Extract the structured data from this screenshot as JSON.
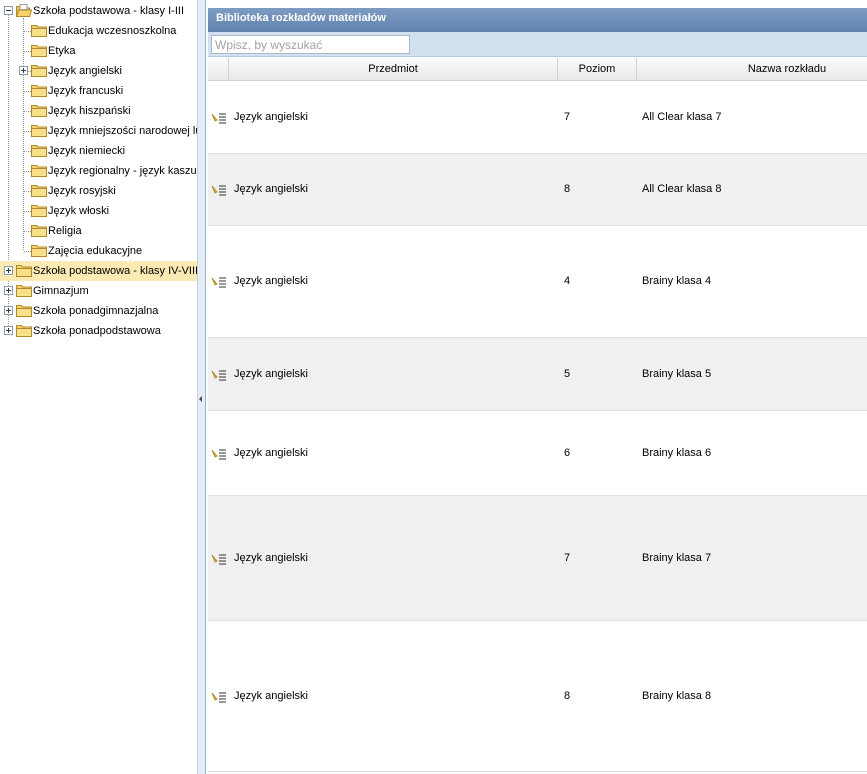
{
  "tree": {
    "items": [
      {
        "label": "Szkoła podstawowa - klasy I-III",
        "level": 0,
        "expander": "minus",
        "open": true,
        "selected": false
      },
      {
        "label": "Edukacja wczesnoszkolna",
        "level": 1,
        "expander": "none",
        "open": false,
        "selected": false
      },
      {
        "label": "Etyka",
        "level": 1,
        "expander": "none",
        "open": false,
        "selected": false
      },
      {
        "label": "Język angielski",
        "level": 1,
        "expander": "plus",
        "open": false,
        "selected": false
      },
      {
        "label": "Język francuski",
        "level": 1,
        "expander": "none",
        "open": false,
        "selected": false
      },
      {
        "label": "Język hiszpański",
        "level": 1,
        "expander": "none",
        "open": false,
        "selected": false
      },
      {
        "label": "Język mniejszości narodowej lu",
        "level": 1,
        "expander": "none",
        "open": false,
        "selected": false
      },
      {
        "label": "Język niemiecki",
        "level": 1,
        "expander": "none",
        "open": false,
        "selected": false
      },
      {
        "label": "Język regionalny - język kaszub",
        "level": 1,
        "expander": "none",
        "open": false,
        "selected": false
      },
      {
        "label": "Język rosyjski",
        "level": 1,
        "expander": "none",
        "open": false,
        "selected": false
      },
      {
        "label": "Język włoski",
        "level": 1,
        "expander": "none",
        "open": false,
        "selected": false
      },
      {
        "label": "Religia",
        "level": 1,
        "expander": "none",
        "open": false,
        "selected": false
      },
      {
        "label": "Zajęcia edukacyjne",
        "level": 1,
        "expander": "none",
        "open": false,
        "selected": false
      },
      {
        "label": "Szkoła podstawowa - klasy IV-VIII",
        "level": 0,
        "expander": "plus",
        "open": false,
        "selected": true
      },
      {
        "label": "Gimnazjum",
        "level": 0,
        "expander": "plus",
        "open": false,
        "selected": false
      },
      {
        "label": "Szkoła ponadgimnazjalna",
        "level": 0,
        "expander": "plus",
        "open": false,
        "selected": false
      },
      {
        "label": "Szkoła ponadpodstawowa",
        "level": 0,
        "expander": "plus",
        "open": false,
        "selected": false
      }
    ]
  },
  "panel": {
    "title": "Biblioteka rozkładów materiałów",
    "search_placeholder": "Wpisz, by wyszukać",
    "columns": {
      "subject": "Przedmiot",
      "level": "Poziom",
      "name": "Nazwa rozkładu"
    },
    "rows": [
      {
        "subject": "Język angielski",
        "level": "7",
        "name": "All Clear klasa 7"
      },
      {
        "subject": "Język angielski",
        "level": "8",
        "name": "All Clear klasa 8"
      },
      {
        "subject": "Język angielski",
        "level": "4",
        "name": "Brainy klasa 4"
      },
      {
        "subject": "Język angielski",
        "level": "5",
        "name": "Brainy klasa 5"
      },
      {
        "subject": "Język angielski",
        "level": "6",
        "name": "Brainy klasa 6"
      },
      {
        "subject": "Język angielski",
        "level": "7",
        "name": "Brainy klasa 7"
      },
      {
        "subject": "Język angielski",
        "level": "8",
        "name": "Brainy klasa 8"
      }
    ]
  },
  "colors": {
    "selected": "#fbeab3",
    "header": "#5f82ad",
    "toolbar": "#d3e0ef",
    "folder": "#f5d36a"
  }
}
